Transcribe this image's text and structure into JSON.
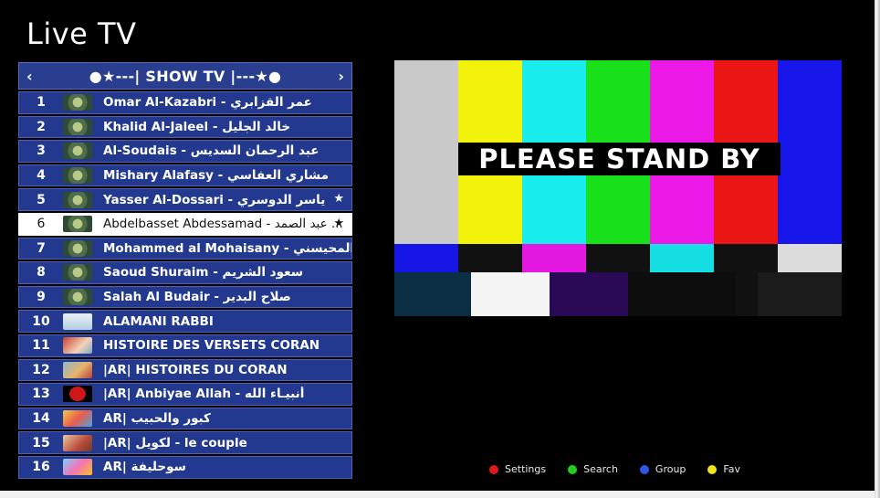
{
  "header": {
    "title": "Live TV"
  },
  "group": {
    "prev_icon": "chevron-left-icon",
    "next_icon": "chevron-right-icon",
    "prev_glyph": "‹",
    "next_glyph": "›",
    "name": "●★---| SHOW TV |---★●"
  },
  "channels": [
    {
      "number": "1",
      "name": "Omar Al-Kazabri - عمر القزابري",
      "logo": "quran-logo",
      "fav": false
    },
    {
      "number": "2",
      "name": "Khalid Al-Jaleel - خالد الجليل",
      "logo": "quran-logo",
      "fav": false
    },
    {
      "number": "3",
      "name": "Al-Soudais - عبد الرحمان السديس",
      "logo": "quran-logo",
      "fav": false
    },
    {
      "number": "4",
      "name": "Mishary Alafasy - مشاري العفاسي",
      "logo": "quran-logo",
      "fav": false
    },
    {
      "number": "5",
      "name": "Yasser Al-Dossari - ياسر الدوسري",
      "logo": "quran-logo",
      "fav": true
    },
    {
      "number": "6",
      "name": "Abdelbasset Abdessamad - عبد الصمد ...",
      "logo": "quran-logo",
      "fav": true,
      "selected": true
    },
    {
      "number": "7",
      "name": "Mohammed al Mohaisany - د المحيسني...",
      "logo": "quran-logo",
      "fav": false
    },
    {
      "number": "8",
      "name": "Saoud Shuraim - سعود الشريم",
      "logo": "quran-logo",
      "fav": false
    },
    {
      "number": "9",
      "name": "Salah Al Budair - صلاح البدير",
      "logo": "quran-logo",
      "fav": false
    },
    {
      "number": "10",
      "name": "ALAMANI RABBI",
      "logo": "alamani-logo",
      "fav": false
    },
    {
      "number": "11",
      "name": "HISTOIRE DES VERSETS CORAN",
      "logo": "histoire-logo",
      "fav": false
    },
    {
      "number": "12",
      "name": "|AR| HISTOIRES DU CORAN",
      "logo": "histoire-ar-logo",
      "fav": false
    },
    {
      "number": "13",
      "name": "|AR| Anbiyae Allah - أنبيـاء الله",
      "logo": "anbiyae-logo",
      "fav": false
    },
    {
      "number": "14",
      "name": "AR| كبور والحبيب",
      "logo": "kbour-logo",
      "fav": false
    },
    {
      "number": "15",
      "name": "|AR| لكويل - le couple",
      "logo": "couple-logo",
      "fav": false
    },
    {
      "number": "16",
      "name": "AR| سوحليفة",
      "logo": "souh-logo",
      "fav": false
    }
  ],
  "player": {
    "overlay_text": "PLEASE STAND BY"
  },
  "legend": [
    {
      "label": "Settings",
      "color": "#e0191b"
    },
    {
      "label": "Search",
      "color": "#1fd01f"
    },
    {
      "label": "Group",
      "color": "#2a59e8"
    },
    {
      "label": "Fav",
      "color": "#f2e21a"
    }
  ],
  "colors": {
    "list_bg": "#22398f",
    "selected_bg": "#ffffff",
    "background": "#000000"
  }
}
